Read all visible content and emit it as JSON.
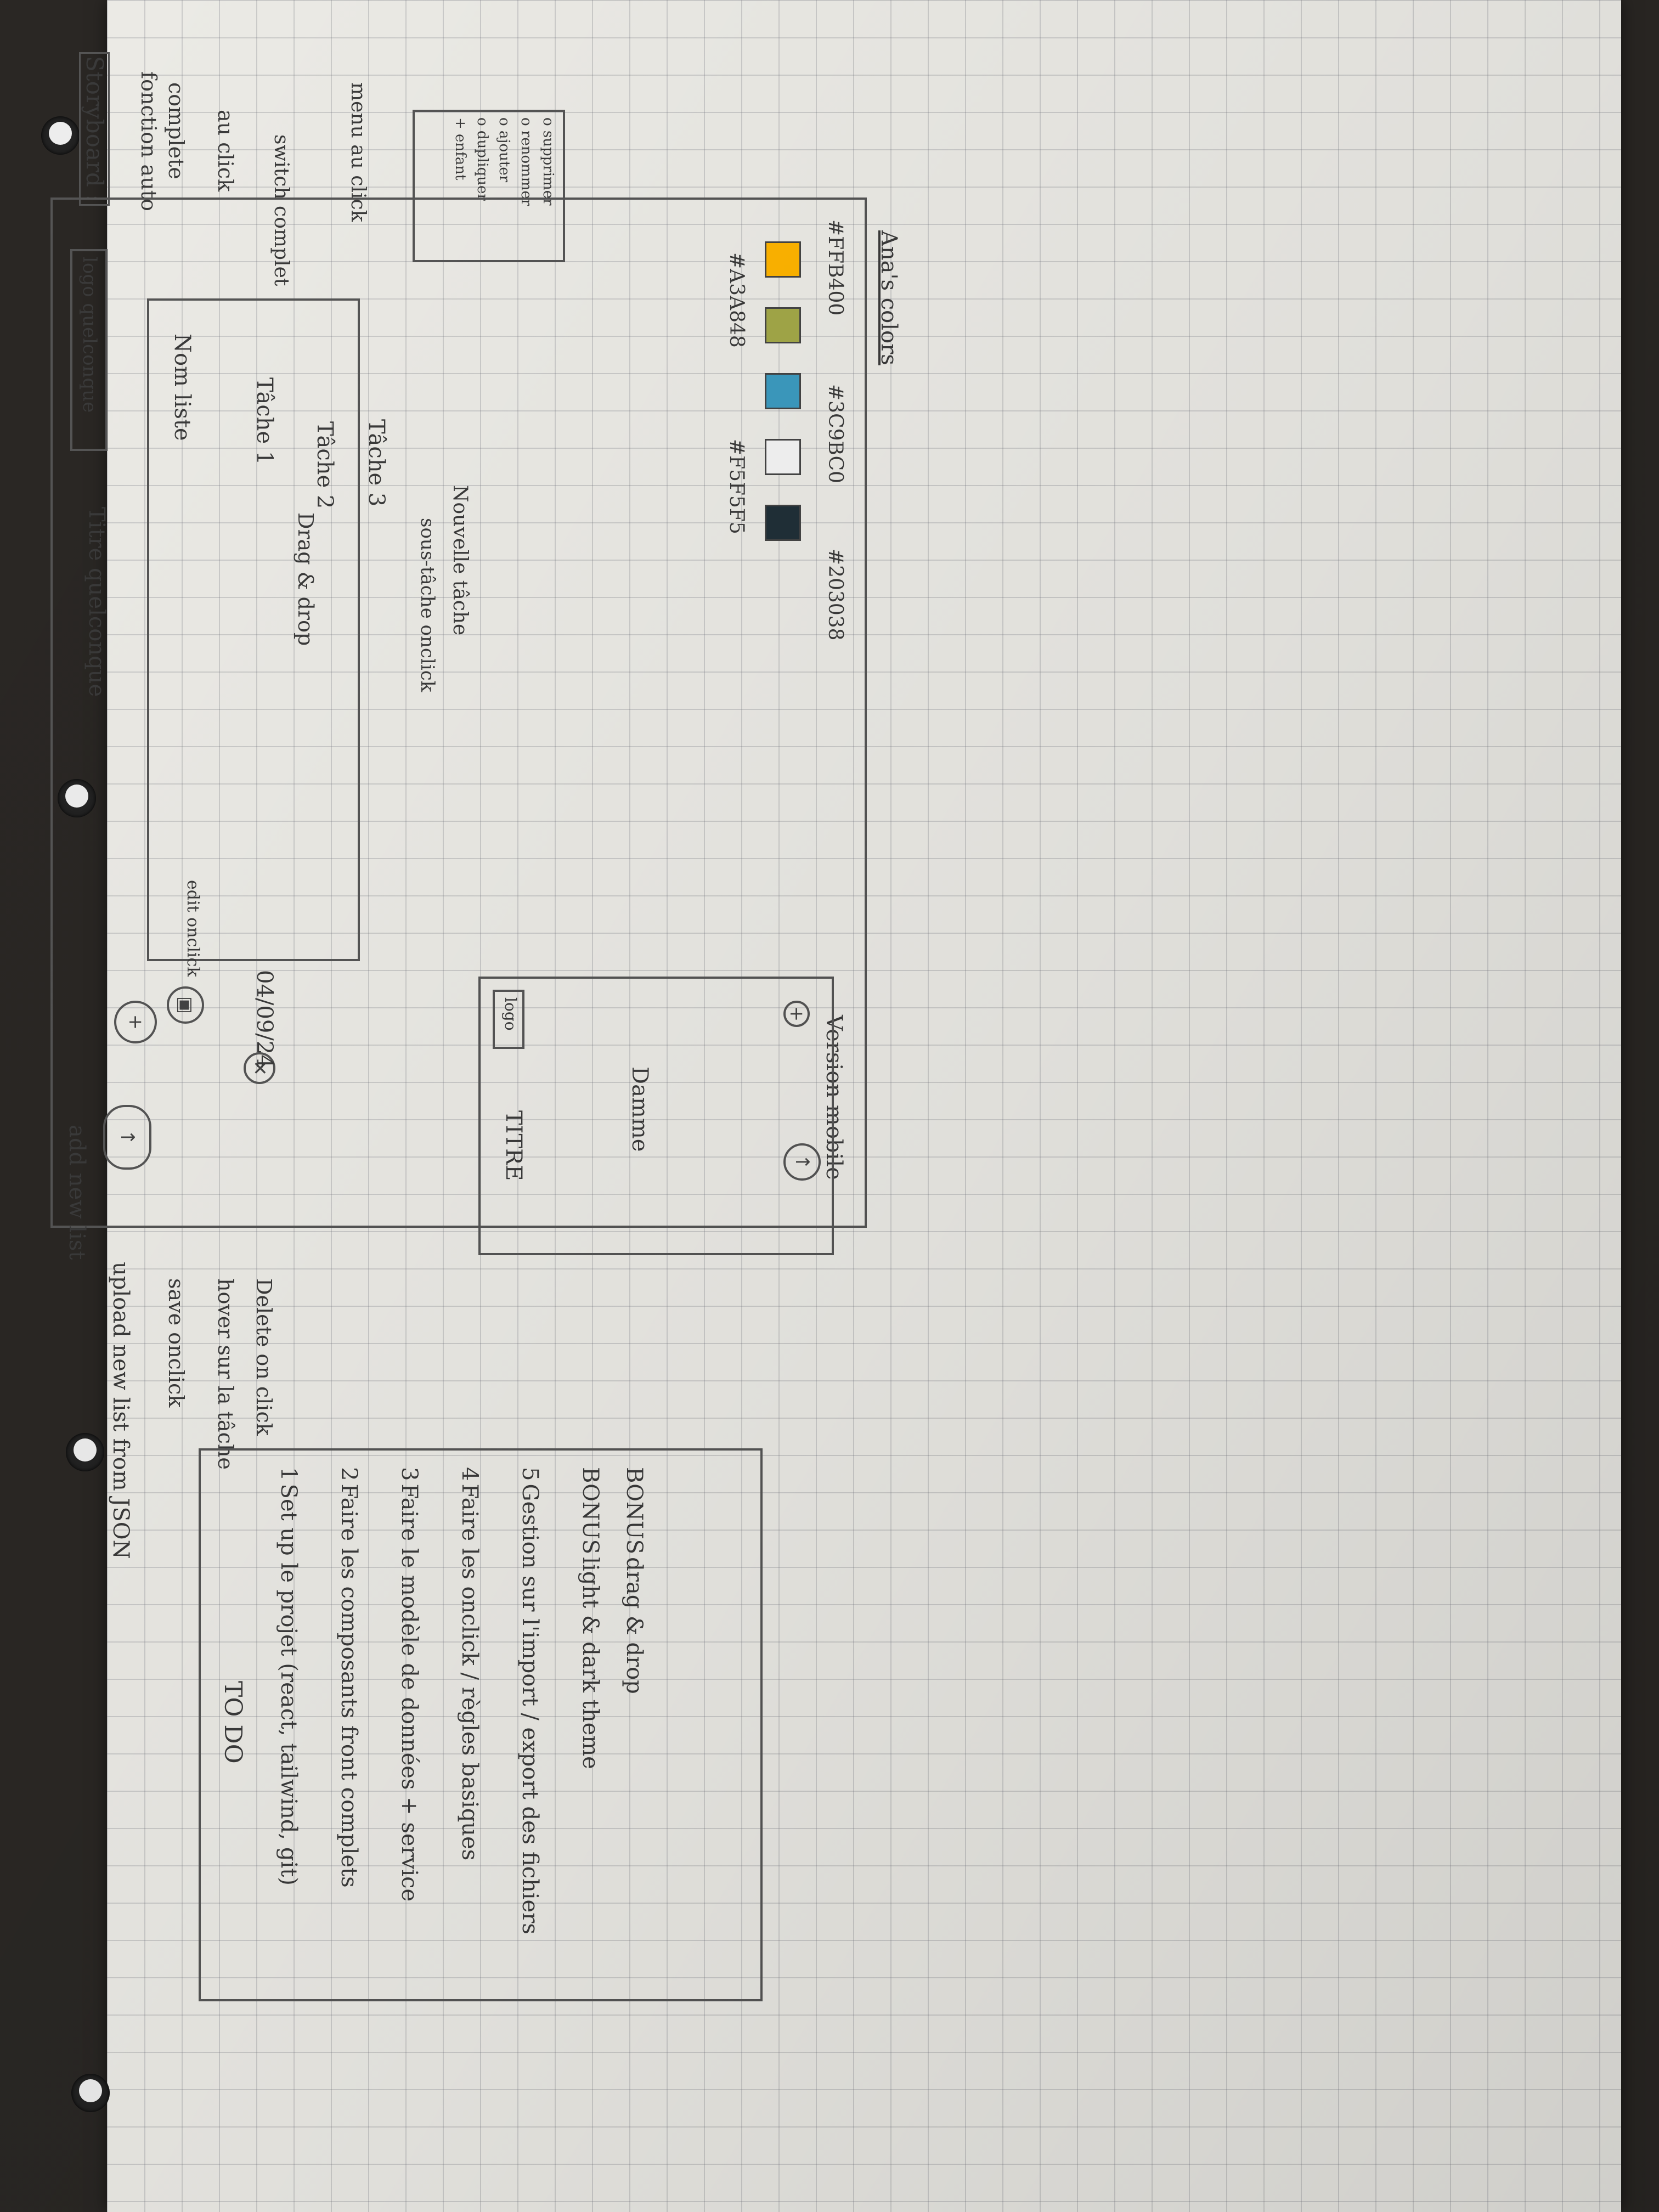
{
  "title": "Storyboard :",
  "left_notes": {
    "function_auto": "fonction auto",
    "complete": "complete",
    "au_click": "au click",
    "switch_complet": "switch complet",
    "menu_on_click": "menu au click",
    "menu_items": [
      "o supprimer",
      "o renommer",
      "o ajouter",
      "o dupliquer",
      "+ enfant"
    ]
  },
  "desktop": {
    "logo": "logo quelconque",
    "title": "Titre quelconque",
    "list_name": "Nom liste",
    "edit_note": "edit onclick",
    "tasks": [
      "Tâche 1",
      "Tâche 2",
      "Tâche 3"
    ],
    "subtask_note": "sous-tâche onclick",
    "new_task": "Nouvelle tâche",
    "drag_note": "Drag & drop",
    "date": "04/09/24"
  },
  "annotations": {
    "add_list": "add new list",
    "upload": "upload new list from JSON",
    "save": "save onclick",
    "hover": "hover sur la tâche",
    "delete": "Delete on click"
  },
  "colors": {
    "label": "Ana's colors",
    "swatches": [
      {
        "hex": "#FFB400",
        "label": "#FFB400"
      },
      {
        "hex": "#3C9BC0",
        "label": "#3C9BC0"
      },
      {
        "hex": "#203038",
        "label": "#203038"
      },
      {
        "hex": "#A3A848",
        "label": "#A3A848"
      },
      {
        "hex": "#F5F5F5",
        "label": "#F5F5F5"
      }
    ]
  },
  "mobile": {
    "label": "Version mobile",
    "logo": "logo",
    "title": "TITRE",
    "name": "Damme"
  },
  "todo": {
    "title": "TO DO",
    "items": [
      {
        "n": "1",
        "text": "Set up le projet (react, tailwind, git)"
      },
      {
        "n": "2",
        "text": "Faire les composants front complets"
      },
      {
        "n": "3",
        "text": "Faire le modèle de données + service"
      },
      {
        "n": "4",
        "text": "Faire les onclick / règles basiques"
      },
      {
        "n": "5",
        "text": "Gestion sur l'import / export des fichiers"
      },
      {
        "n": "BONUS",
        "text": "light & dark theme"
      },
      {
        "n": "BONUS",
        "text": "drag & drop"
      }
    ]
  }
}
